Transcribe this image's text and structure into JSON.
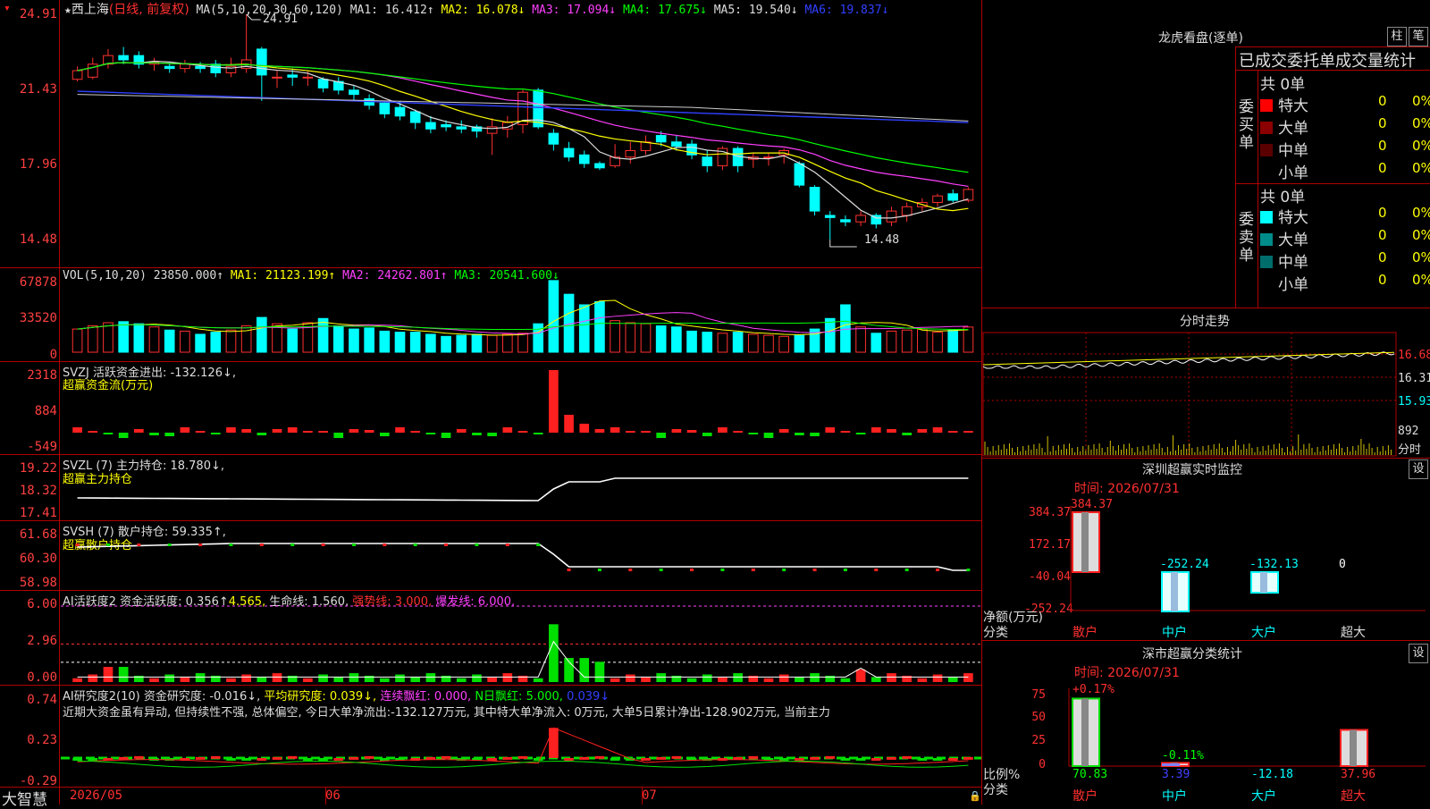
{
  "main_chart": {
    "title_star": "★",
    "stock_name": "西上海",
    "period": "(日线, 前复权)",
    "ma_params": "MA(5,10,20,30,60,120)",
    "ma1": "MA1: 16.412↑",
    "ma2": "MA2: 16.078↓",
    "ma3": "MA3: 17.094↓",
    "ma4": "MA4: 17.675↓",
    "ma5": "MA5: 19.540↓",
    "ma6": "MA6: 19.837↓",
    "y_ticks": [
      "24.91",
      "21.43",
      "17.96",
      "14.48"
    ],
    "high_label": "24.91",
    "low_label": "14.48"
  },
  "volume": {
    "params": "VOL(5,10,20)",
    "value": "23850.000↑",
    "ma1": "MA1: 21123.199↑",
    "ma2": "MA2: 24262.801↑",
    "ma3": "MA3: 20541.600↓",
    "y_ticks": [
      "67878",
      "33520",
      "0"
    ]
  },
  "svzj": {
    "label": "SVZJ  活跃资金进出: -132.126↓,",
    "sub": "超赢资金流(万元)",
    "y_ticks": [
      "2318",
      "884",
      "-549"
    ]
  },
  "svzl": {
    "label": "SVZL (7) 主力持仓: 18.780↓,",
    "sub": "超赢主力持仓",
    "y_ticks": [
      "19.22",
      "18.32",
      "17.41"
    ]
  },
  "svsh": {
    "label": "SVSH (7) 散户持仓: 59.335↑,",
    "sub": "超赢散户持仓",
    "y_ticks": [
      "61.68",
      "60.30",
      "58.98"
    ]
  },
  "ai_active": {
    "label": "AI活跃度2 资金活跃度: 0.356↑",
    "v2": "4.565,",
    "life": "生命线: 1.560,",
    "strong": "强势线: 3.000,",
    "burst": "爆发线: 6.000,",
    "y_ticks": [
      "6.00",
      "2.96",
      "0.00"
    ]
  },
  "ai_research": {
    "label": "AI研究度2(10) 资金研究度: -0.016↓,",
    "avg": "平均研究度: 0.039↓,",
    "cont": "连续飘红: 0.000,",
    "nday": "N日飘红: 5.000,",
    "last": "0.039↓",
    "comment": "近期大资金虽有异动, 但持续性不强, 总体偏空, 今日大单净流出:-132.127万元, 其中特大单净流入: 0万元, 大单5日累计净出-128.902万元, 当前主力",
    "y_ticks": [
      "0.74",
      "0.23",
      "-0.29"
    ]
  },
  "x_axis": {
    "brand": "大智慧",
    "labels": [
      "2026/05",
      "06",
      "07"
    ]
  },
  "dragon_tiger": {
    "title": "龙虎看盘(逐单)",
    "btn1": "柱",
    "btn2": "笔",
    "subtitle": "已成交委托单成交量统计",
    "buy_label": "委买单",
    "sell_label": "委卖单",
    "buy_total": "共 0单",
    "sell_total": "共 0单",
    "buy_rows": [
      {
        "name": "特大",
        "count": "0",
        "pct": "0%",
        "color": "#ff0000"
      },
      {
        "name": "大单",
        "count": "0",
        "pct": "0%",
        "color": "#8b0000"
      },
      {
        "name": "中单",
        "count": "0",
        "pct": "0%",
        "color": "#5a0000"
      },
      {
        "name": "小单",
        "count": "0",
        "pct": "0%",
        "color": ""
      }
    ],
    "sell_rows": [
      {
        "name": "特大",
        "count": "0",
        "pct": "0%",
        "color": "#00ffff"
      },
      {
        "name": "大单",
        "count": "0",
        "pct": "0%",
        "color": "#008b8b"
      },
      {
        "name": "中单",
        "count": "0",
        "pct": "0%",
        "color": "#006d6d"
      },
      {
        "name": "小单",
        "count": "0",
        "pct": "0%",
        "color": ""
      }
    ]
  },
  "intraday": {
    "title": "分时走势",
    "y_ticks": [
      "16.68",
      "16.31",
      "15.93"
    ],
    "vol_tick": "892",
    "vol_unit": "分时"
  },
  "sz_monitor": {
    "title": "深圳超赢实时监控",
    "settings": "设",
    "time": "时间: 2026/07/31",
    "y_ticks": [
      "384.37",
      "172.17",
      "-40.04",
      "-252.24"
    ],
    "ylabel": "净额(万元)",
    "xlabel": "分类",
    "bars": [
      {
        "cat": "散户",
        "value": 384.37,
        "label": "384.37"
      },
      {
        "cat": "中户",
        "value": -252.24,
        "label": "-252.24"
      },
      {
        "cat": "大户",
        "value": -132.13,
        "label": "-132.13"
      },
      {
        "cat": "超大",
        "value": 0,
        "label": "0"
      }
    ]
  },
  "sz_category": {
    "title": "深市超赢分类统计",
    "settings": "设",
    "time": "时间: 2026/07/31",
    "y_ticks": [
      "75",
      "50",
      "25",
      "0"
    ],
    "ylabel": "比例%",
    "xlabel": "分类",
    "top_labels": [
      "+0.17%",
      "-0.11%"
    ],
    "bars": [
      {
        "cat": "散户",
        "value": 70.83,
        "label": "70.83"
      },
      {
        "cat": "中户",
        "value": 3.39,
        "label": "3.39"
      },
      {
        "cat": "大户",
        "value": -12.18,
        "label": "-12.18"
      },
      {
        "cat": "超大",
        "value": 37.96,
        "label": "37.96"
      }
    ]
  },
  "candles": [
    [
      21.9,
      22.3,
      21.8,
      22.5
    ],
    [
      22.0,
      22.6,
      21.9,
      22.9
    ],
    [
      22.6,
      23.0,
      22.4,
      23.3
    ],
    [
      23.0,
      22.8,
      22.6,
      23.4
    ],
    [
      23.0,
      22.6,
      22.4,
      23.2
    ],
    [
      22.6,
      22.7,
      22.3,
      22.9
    ],
    [
      22.5,
      22.4,
      22.2,
      22.7
    ],
    [
      22.4,
      22.6,
      22.2,
      22.8
    ],
    [
      22.5,
      22.4,
      22.2,
      22.7
    ],
    [
      22.6,
      22.2,
      22.0,
      22.8
    ],
    [
      22.2,
      22.5,
      22.0,
      22.9
    ],
    [
      22.4,
      22.8,
      22.2,
      24.91
    ],
    [
      23.3,
      22.1,
      20.9,
      23.4
    ],
    [
      22.0,
      22.0,
      21.5,
      22.3
    ],
    [
      22.1,
      22.0,
      21.6,
      22.4
    ],
    [
      22.0,
      22.0,
      21.6,
      22.3
    ],
    [
      21.9,
      21.5,
      21.3,
      22.0
    ],
    [
      21.8,
      21.4,
      21.2,
      22.0
    ],
    [
      21.4,
      21.2,
      20.9,
      21.6
    ],
    [
      21.0,
      20.7,
      20.5,
      21.2
    ],
    [
      20.8,
      20.3,
      20.1,
      20.9
    ],
    [
      20.6,
      20.2,
      20.0,
      20.9
    ],
    [
      20.4,
      19.9,
      19.6,
      20.5
    ],
    [
      19.9,
      19.6,
      19.4,
      20.2
    ],
    [
      19.8,
      19.7,
      19.5,
      20.0
    ],
    [
      19.7,
      19.6,
      19.4,
      20.0
    ],
    [
      19.7,
      19.5,
      19.2,
      19.8
    ],
    [
      19.4,
      19.7,
      18.4,
      20.1
    ],
    [
      19.6,
      19.9,
      19.2,
      20.2
    ],
    [
      19.8,
      21.3,
      19.4,
      21.4
    ],
    [
      21.4,
      19.7,
      19.6,
      21.5
    ],
    [
      19.4,
      18.9,
      18.6,
      19.6
    ],
    [
      18.7,
      18.3,
      18.1,
      19.0
    ],
    [
      18.4,
      18.0,
      17.8,
      18.6
    ],
    [
      18.0,
      17.8,
      17.7,
      18.1
    ],
    [
      17.9,
      18.3,
      17.8,
      18.9
    ],
    [
      18.3,
      18.6,
      18.0,
      19.0
    ],
    [
      18.6,
      19.0,
      18.4,
      19.3
    ],
    [
      19.3,
      19.0,
      18.8,
      19.5
    ],
    [
      19.0,
      18.8,
      18.6,
      19.3
    ],
    [
      18.9,
      18.4,
      18.2,
      19.1
    ],
    [
      18.3,
      17.9,
      17.6,
      18.6
    ],
    [
      17.9,
      18.7,
      17.7,
      18.8
    ],
    [
      18.7,
      17.9,
      17.6,
      18.8
    ],
    [
      18.2,
      18.3,
      17.8,
      18.5
    ],
    [
      18.3,
      18.3,
      17.9,
      18.5
    ],
    [
      18.4,
      18.6,
      18.0,
      18.7
    ],
    [
      18.0,
      17.0,
      16.9,
      18.1
    ],
    [
      16.9,
      15.8,
      15.6,
      17.0
    ],
    [
      15.6,
      15.5,
      14.48,
      15.8
    ],
    [
      15.4,
      15.3,
      15.1,
      15.6
    ],
    [
      15.3,
      15.6,
      15.1,
      15.8
    ],
    [
      15.6,
      15.2,
      15.0,
      15.7
    ],
    [
      15.3,
      15.8,
      15.1,
      16.0
    ],
    [
      15.6,
      16.0,
      15.3,
      16.2
    ],
    [
      16.0,
      16.2,
      15.8,
      16.4
    ],
    [
      16.2,
      16.5,
      16.0,
      16.6
    ],
    [
      16.6,
      16.3,
      16.2,
      16.8
    ],
    [
      16.3,
      16.8,
      16.2,
      16.9
    ]
  ],
  "volumes": [
    22000,
    25000,
    28000,
    29000,
    27000,
    24000,
    21000,
    20000,
    17000,
    19000,
    21000,
    25000,
    33000,
    27000,
    22000,
    28000,
    32000,
    25000,
    22000,
    23000,
    20000,
    19000,
    19000,
    17000,
    15000,
    16000,
    17000,
    16000,
    17000,
    18000,
    27000,
    68000,
    55000,
    45000,
    48000,
    30000,
    28000,
    27000,
    25000,
    24000,
    20000,
    19000,
    18000,
    19000,
    17000,
    16000,
    15000,
    16000,
    22000,
    32000,
    45000,
    24000,
    18000,
    20000,
    21000,
    22000,
    19000,
    21000,
    23850
  ]
}
